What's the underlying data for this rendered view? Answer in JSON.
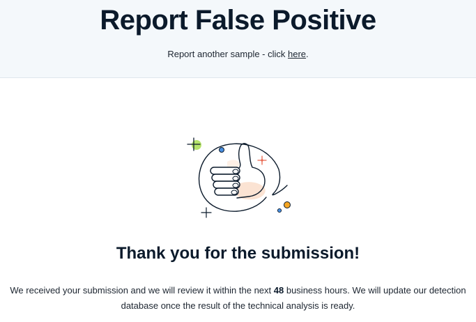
{
  "header": {
    "title": "Report False Positive",
    "subtitle_prefix": "Report another sample - click ",
    "subtitle_link": "here",
    "subtitle_suffix": "."
  },
  "illustration": {
    "icon": "thumbs-up-icon",
    "accent_colors": [
      "#b6e36b",
      "#f5a623",
      "#4a90e2",
      "#e8664f",
      "#fbe3d3"
    ]
  },
  "confirmation": {
    "heading": "Thank you for the submission!",
    "message_part1": "We received your submission and we will review it within the next ",
    "message_hours": "48",
    "message_part2": " business hours. We will update our detection database once the result of the technical analysis is ready."
  }
}
